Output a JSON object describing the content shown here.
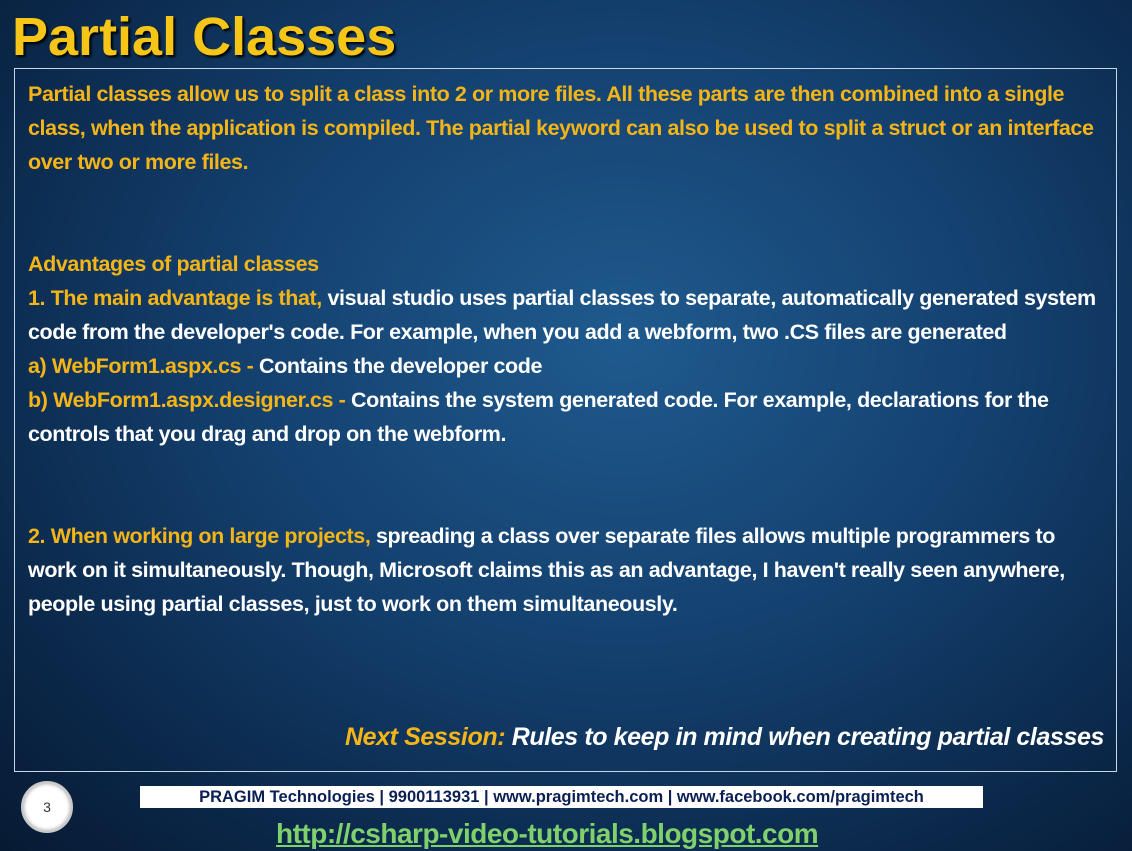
{
  "slide": {
    "title": "Partial Classes",
    "intro": "Partial classes allow us to split a class into 2 or more files.  All these parts are then combined into a single class, when the application is compiled. The partial keyword can also be used to split a struct or an interface over two or more files.",
    "advantages_heading": "Advantages of partial classes",
    "adv1_lead": "1. The main advantage is that,",
    "adv1_text": "visual studio uses partial classes to separate, automatically generated system code from the developer's code. For example, when you add a webform, two .CS files are generated",
    "adv1_a_lead": "a) WebForm1.aspx.cs -",
    "adv1_a_text": "Contains the developer code",
    "adv1_b_lead": "b) WebForm1.aspx.designer.cs -",
    "adv1_b_text": "Contains the system generated code. For example, declarations for the controls that you drag and drop on the webform.",
    "adv2_lead": "2. When working on large projects,",
    "adv2_text": "spreading a class over separate files allows multiple programmers to work on it simultaneously. Though, Microsoft claims this as an advantage, I haven't really seen anywhere, people using partial classes, just to work on them simultaneously.",
    "next_label": "Next Session:",
    "next_text": "Rules  to keep in mind when creating partial classes",
    "slide_number": "3"
  },
  "footer": {
    "company_line": "PRAGIM Technologies | 9900113931 | www.pragimtech.com | www.facebook.com/pragimtech",
    "blog_url": "http://csharp-video-tutorials.blogspot.com"
  },
  "colors": {
    "accent_yellow": "#f5b516",
    "title_yellow": "#f5c518",
    "body_white": "#ffffff",
    "link_green": "#7fd16b",
    "background_blue": "#133f6d"
  }
}
